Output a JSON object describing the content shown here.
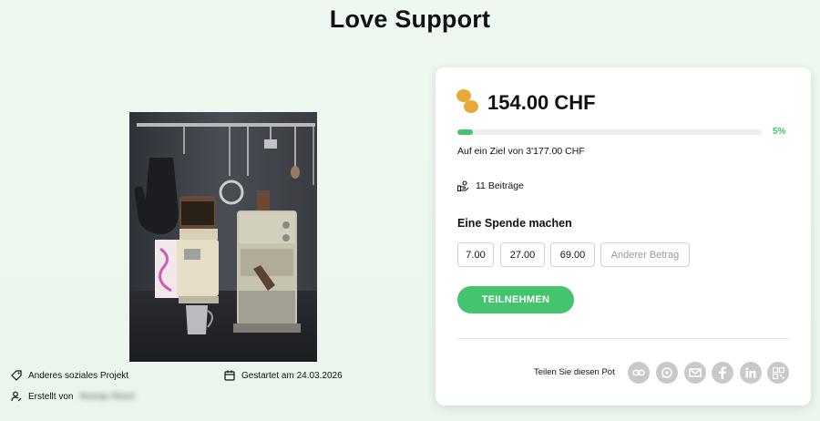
{
  "page": {
    "title": "Love Support"
  },
  "project": {
    "category": "Anderes soziales Projekt",
    "started": "Gestartet am 24.03.2026",
    "created_by_label": "Erstellt von",
    "creator_name": "Roman Rezni"
  },
  "pot": {
    "amount": "154.00 CHF",
    "progress_percent": 5,
    "progress_label": "5%",
    "goal_text": "Auf ein Ziel von 3'177.00 CHF",
    "contributions": "11 Beiträge",
    "donate_title": "Eine Spende machen",
    "amount_options": [
      "7.00",
      "27.00",
      "69.00"
    ],
    "other_amount": "Anderer Betrag",
    "cta_label": "TEILNEHMEN",
    "share_label": "Teilen Sie diesen Pot"
  },
  "colors": {
    "accent": "#43c46d",
    "coin": "#e8a93a",
    "share_icon_bg": "#c9c9c9"
  },
  "share_icons": [
    "link-icon",
    "whatsapp-icon",
    "email-icon",
    "facebook-icon",
    "linkedin-icon",
    "qr-code-icon"
  ]
}
